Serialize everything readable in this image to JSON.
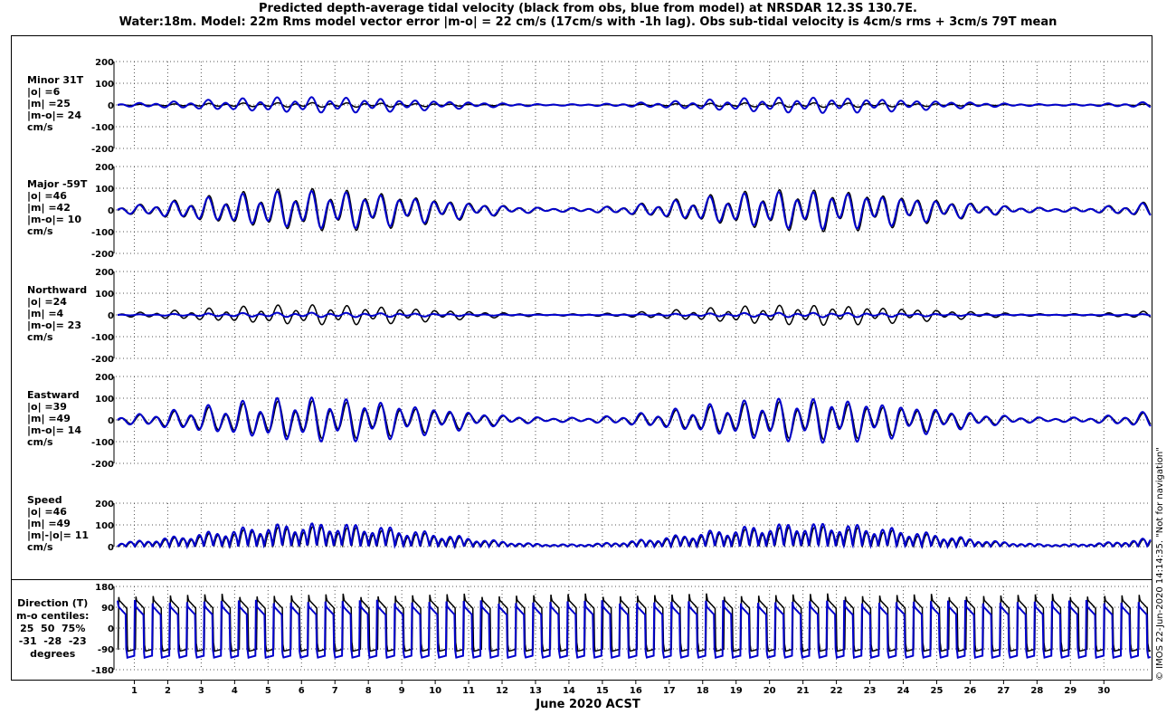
{
  "title_line1": "Predicted depth-average tidal velocity (black from obs, blue from model) at NRSDAR 12.3S 130.7E.",
  "title_line2": "Water:18m. Model: 22m  Rms model vector error |m-o| = 22 cm/s (17cm/s with -1h lag). Obs sub-tidal velocity is 4cm/s rms + 3cm/s 79T mean",
  "xlabel": "June 2020 ACST",
  "footer": "© IMOS 22-Jun-2020 14:14:35. \"Not for navigation\"",
  "colors": {
    "obs": "#000000",
    "model": "#0000cc",
    "grid": "#555555"
  },
  "x_ticks": [
    "1",
    "2",
    "3",
    "4",
    "5",
    "6",
    "7",
    "8",
    "9",
    "10",
    "11",
    "12",
    "13",
    "14",
    "15",
    "16",
    "17",
    "18",
    "19",
    "20",
    "21",
    "22",
    "23",
    "24",
    "25",
    "26",
    "27",
    "28",
    "29",
    "30"
  ],
  "chart_data": [
    {
      "type": "line",
      "panel": "minor",
      "label": "Minor 31T\n|o| =6\n|m| =25\n|m-o|= 24\ncm/s",
      "ylim": [
        -200,
        200
      ],
      "y_ticks": [
        "200",
        "100",
        "0",
        "-100",
        "-200"
      ],
      "series": [
        {
          "name": "black from obs",
          "amplitude": 10
        },
        {
          "name": "blue from model",
          "amplitude": 35
        }
      ]
    },
    {
      "type": "line",
      "panel": "major",
      "label": "Major -59T\n|o| =46\n|m| =42\n|m-o|= 10\ncm/s",
      "ylim": [
        -200,
        200
      ],
      "y_ticks": [
        "200",
        "100",
        "0",
        "-100",
        "-200"
      ],
      "series": [
        {
          "name": "black from obs",
          "amplitude": 95
        },
        {
          "name": "blue from model",
          "amplitude": 85
        }
      ]
    },
    {
      "type": "line",
      "panel": "north",
      "label": "Northward\n|o| =24\n|m| =4\n|m-o|= 23\ncm/s",
      "ylim": [
        -200,
        200
      ],
      "y_ticks": [
        "200",
        "100",
        "0",
        "-100",
        "-200"
      ],
      "series": [
        {
          "name": "black from obs",
          "amplitude": 45
        },
        {
          "name": "blue from model",
          "amplitude": 10
        }
      ]
    },
    {
      "type": "line",
      "panel": "east",
      "label": "Eastward\n|o| =39\n|m| =49\n|m-o|= 14\ncm/s",
      "ylim": [
        -200,
        200
      ],
      "y_ticks": [
        "200",
        "100",
        "0",
        "-100",
        "-200"
      ],
      "series": [
        {
          "name": "black from obs",
          "amplitude": 85
        },
        {
          "name": "blue from model",
          "amplitude": 100
        }
      ]
    },
    {
      "type": "line",
      "panel": "speed",
      "label": "Speed\n|o| =46\n|m| =49\n|m|-|o|= 11\ncm/s",
      "ylim": [
        0,
        200
      ],
      "y_ticks": [
        "200",
        "100",
        "0"
      ],
      "series": [
        {
          "name": "black from obs",
          "amplitude": 95
        },
        {
          "name": "blue from model",
          "amplitude": 110
        }
      ]
    },
    {
      "type": "line",
      "panel": "direction",
      "label": "Direction (T)\nm-o centiles:\n25  50  75%\n-31  -28  -23\ndegrees",
      "ylim": [
        -180,
        180
      ],
      "y_ticks": [
        "180",
        "90",
        "0",
        "-90",
        "-180"
      ],
      "series": [
        {
          "name": "black from obs"
        },
        {
          "name": "blue from model"
        }
      ]
    }
  ]
}
